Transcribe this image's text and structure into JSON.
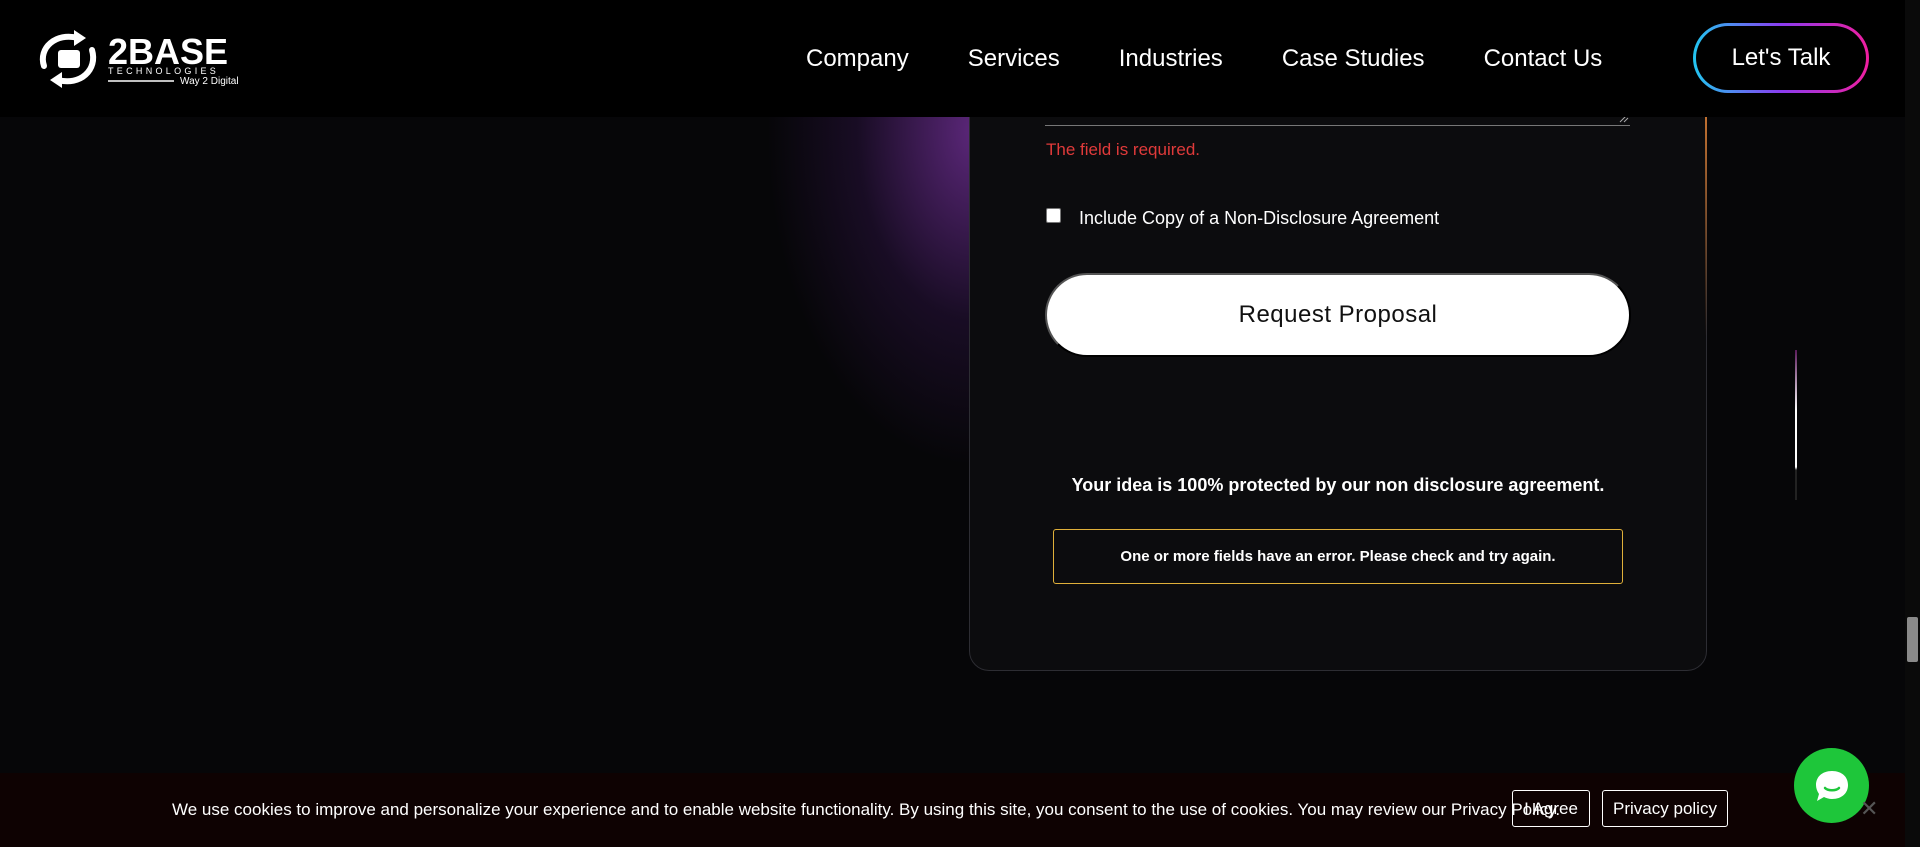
{
  "header": {
    "logo": {
      "name": "2BASE",
      "tagline": "TECHNOLOGIES",
      "subtitle": "Way 2 Digital"
    },
    "nav": [
      "Company",
      "Services",
      "Industries",
      "Case Studies",
      "Contact Us"
    ],
    "cta_label": "Let's Talk"
  },
  "form": {
    "error_message": "The field is required.",
    "nda_checkbox_label": "Include Copy of a Non-Disclosure Agreement",
    "nda_checked": false,
    "submit_label": "Request Proposal",
    "protection_note": "Your idea is 100% protected by our non disclosure agreement.",
    "form_alert": "One or more fields have an error. Please check and try again."
  },
  "cookie_bar": {
    "text": "We use cookies to improve and personalize your experience and to enable website functionality. By using this site, you consent to the use of cookies. You may review our Privacy Policy.",
    "agree_label": "I Agree",
    "privacy_label": "Privacy policy"
  },
  "icons": {
    "chat": "chat-bubble-icon",
    "close": "close-icon",
    "logo": "2base-logo"
  },
  "colors": {
    "error": "#e03a3a",
    "alert_border": "#e0b03a",
    "chat_green": "#1ec63a",
    "cta_gradient_start": "#22c6f0",
    "cta_gradient_end": "#f01ea0"
  }
}
